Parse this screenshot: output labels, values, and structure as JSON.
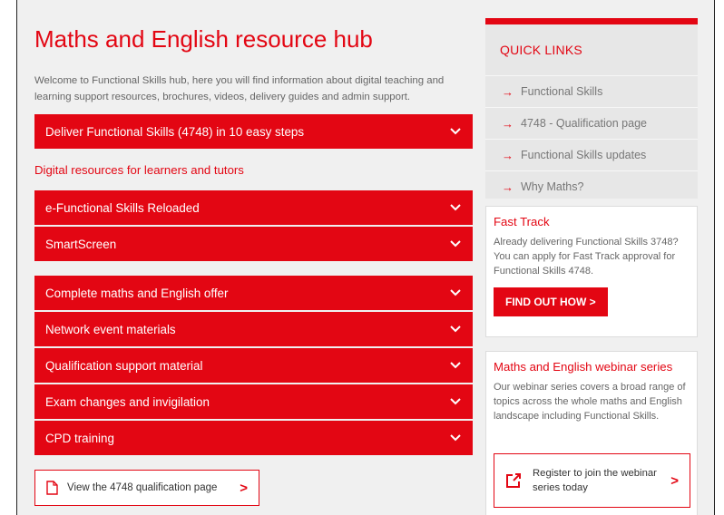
{
  "colors": {
    "accent": "#e30613",
    "panel": "#e7e7e7",
    "background": "#f0f0f0"
  },
  "main": {
    "title": "Maths and English resource hub",
    "intro": "Welcome to Functional Skills hub, here you will find information about digital teaching and learning support resources, brochures, videos, delivery guides and admin support.",
    "accordions_top": [
      {
        "label": "Deliver Functional Skills (4748) in 10 easy steps",
        "icon": "chevron-down-icon"
      }
    ],
    "digital_heading": "Digital resources for learners and tutors",
    "accordions_digital": [
      {
        "label": "e-Functional Skills Reloaded",
        "icon": "chevron-down-icon"
      },
      {
        "label": "SmartScreen",
        "icon": "chevron-down-icon"
      }
    ],
    "accordions_more": [
      {
        "label": "Complete maths and English offer",
        "icon": "chevron-down-icon"
      },
      {
        "label": "Network event materials",
        "icon": "chevron-down-icon"
      },
      {
        "label": "Qualification support material",
        "icon": "chevron-down-icon"
      },
      {
        "label": "Exam changes and invigilation",
        "icon": "chevron-down-icon"
      },
      {
        "label": "CPD training",
        "icon": "chevron-down-icon"
      }
    ],
    "qualification_button": {
      "label": "View the 4748 qualification page",
      "icon": "document-icon",
      "arrow": ">"
    }
  },
  "quick_links": {
    "title": "QUICK LINKS",
    "arrow": "→",
    "items": [
      "Functional Skills",
      "4748 - Qualification page",
      "Functional Skills updates",
      "Why Maths?"
    ]
  },
  "fast_track": {
    "title": "Fast Track",
    "text": "Already delivering Functional Skills 3748? You can apply for Fast Track approval for Functional Skills 4748.",
    "button": "FIND OUT HOW >"
  },
  "webinar": {
    "title": "Maths and English webinar series",
    "text": "Our webinar series covers a broad range of topics across the whole maths and English landscape including Functional Skills.",
    "button": {
      "label": "Register to join the webinar series today",
      "icon": "external-link-icon",
      "arrow": ">"
    }
  }
}
